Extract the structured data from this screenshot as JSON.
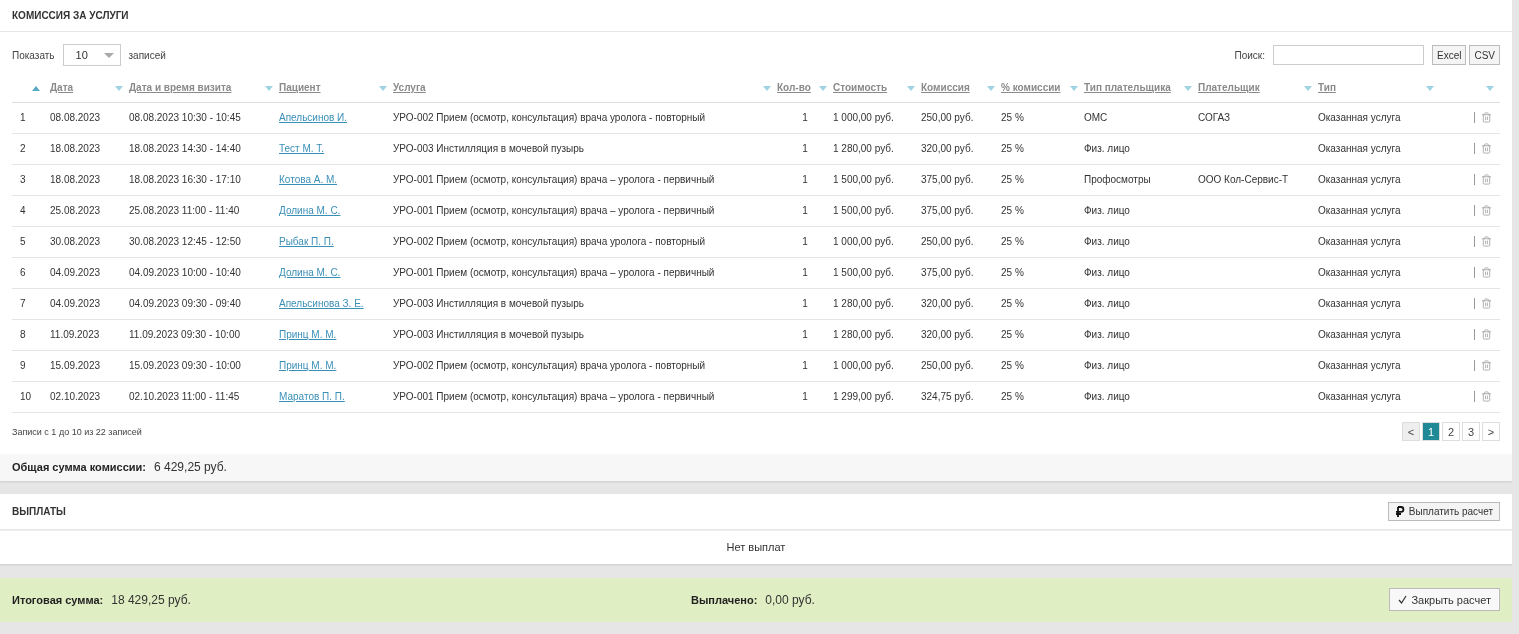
{
  "commission": {
    "title": "КОМИССИЯ ЗА УСЛУГИ",
    "length": {
      "before": "Показать",
      "value": "10",
      "after": "записей"
    },
    "search": {
      "label": "Поиск:"
    },
    "export_buttons": [
      "Excel",
      "CSV"
    ],
    "columns": [
      {
        "sorted": true
      },
      {
        "label": "Дата",
        "sorted": false
      },
      {
        "label": "Дата и время визита",
        "sorted": false
      },
      {
        "label": "Пациент",
        "sorted": false
      },
      {
        "label": "Услуга",
        "sorted": false
      },
      {
        "label": "Кол-во",
        "sorted": false
      },
      {
        "label": "Стоимость",
        "sorted": false
      },
      {
        "label": "Комиссия",
        "sorted": false
      },
      {
        "label": "% комиссии",
        "sorted": false
      },
      {
        "label": "Тип плательщика",
        "sorted": false
      },
      {
        "label": "Плательщик",
        "sorted": false
      },
      {
        "label": "Тип",
        "sorted": false
      },
      {
        "sorted": false
      }
    ],
    "rows": [
      [
        "1",
        "08.08.2023",
        "08.08.2023 10:30 - 10:45",
        "Апельсинов И.",
        "УРО-002 Прием (осмотр, консультация) врача уролога - повторный",
        "1",
        "1 000,00 руб.",
        "250,00 руб.",
        "25 %",
        "ОМС",
        "СОГАЗ",
        "Оказанная услуга"
      ],
      [
        "2",
        "18.08.2023",
        "18.08.2023 14:30 - 14:40",
        "Тест М. Т.",
        "УРО-003 Инстилляция в мочевой пузырь",
        "1",
        "1 280,00 руб.",
        "320,00 руб.",
        "25 %",
        "Физ. лицо",
        "",
        "Оказанная услуга"
      ],
      [
        "3",
        "18.08.2023",
        "18.08.2023 16:30 - 17:10",
        "Котова А. М.",
        "УРО-001 Прием (осмотр, консультация) врача – уролога - первичный",
        "1",
        "1 500,00 руб.",
        "375,00 руб.",
        "25 %",
        "Профосмотры",
        "ООО Кол-Сервис-Т",
        "Оказанная услуга"
      ],
      [
        "4",
        "25.08.2023",
        "25.08.2023 11:00 - 11:40",
        "Долина М. С.",
        "УРО-001 Прием (осмотр, консультация) врача – уролога - первичный",
        "1",
        "1 500,00 руб.",
        "375,00 руб.",
        "25 %",
        "Физ. лицо",
        "",
        "Оказанная услуга"
      ],
      [
        "5",
        "30.08.2023",
        "30.08.2023 12:45 - 12:50",
        "Рыбак П. П.",
        "УРО-002 Прием (осмотр, консультация) врача уролога - повторный",
        "1",
        "1 000,00 руб.",
        "250,00 руб.",
        "25 %",
        "Физ. лицо",
        "",
        "Оказанная услуга"
      ],
      [
        "6",
        "04.09.2023",
        "04.09.2023 10:00 - 10:40",
        "Долина М. С.",
        "УРО-001 Прием (осмотр, консультация) врача – уролога - первичный",
        "1",
        "1 500,00 руб.",
        "375,00 руб.",
        "25 %",
        "Физ. лицо",
        "",
        "Оказанная услуга"
      ],
      [
        "7",
        "04.09.2023",
        "04.09.2023 09:30 - 09:40",
        "Апельсинова З. Е.",
        "УРО-003 Инстилляция в мочевой пузырь",
        "1",
        "1 280,00 руб.",
        "320,00 руб.",
        "25 %",
        "Физ. лицо",
        "",
        "Оказанная услуга"
      ],
      [
        "8",
        "11.09.2023",
        "11.09.2023 09:30 - 10:00",
        "Принц М. М.",
        "УРО-003 Инстилляция в мочевой пузырь",
        "1",
        "1 280,00 руб.",
        "320,00 руб.",
        "25 %",
        "Физ. лицо",
        "",
        "Оказанная услуга"
      ],
      [
        "9",
        "15.09.2023",
        "15.09.2023 09:30 - 10:00",
        "Принц М. М.",
        "УРО-002 Прием (осмотр, консультация) врача уролога - повторный",
        "1",
        "1 000,00 руб.",
        "250,00 руб.",
        "25 %",
        "Физ. лицо",
        "",
        "Оказанная услуга"
      ],
      [
        "10",
        "02.10.2023",
        "02.10.2023 11:00 - 11:45",
        "Маратов П. П.",
        "УРО-001 Прием (осмотр, консультация) врача – уролога - первичный",
        "1",
        "1 299,00 руб.",
        "324,75 руб.",
        "25 %",
        "Физ. лицо",
        "",
        "Оказанная услуга"
      ]
    ],
    "info": "Записи с 1 до 10 из 22 записей",
    "pagination": {
      "prev": "<",
      "pages": [
        {
          "label": "1",
          "selected": true
        },
        {
          "label": "2",
          "selected": false
        },
        {
          "label": "3",
          "selected": false
        }
      ],
      "next": ">"
    },
    "total": {
      "label": "Общая сумма комиссии:",
      "value": "6 429,25 руб."
    }
  },
  "payouts": {
    "title": "ВЫПЛАТЫ",
    "button": "Выплатить расчет",
    "empty": "Нет выплат"
  },
  "summary": {
    "total_label": "Итоговая сумма:",
    "total_value": "18 429,25 руб.",
    "paid_label": "Выплачено:",
    "paid_value": "0,00 руб.",
    "button": "Закрыть расчет"
  }
}
